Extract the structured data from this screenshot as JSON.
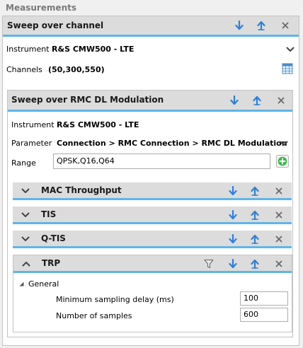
{
  "panel": {
    "title": "Measurements"
  },
  "sweep_channel": {
    "title": "Sweep over channel",
    "instrument_label": "Instrument",
    "instrument_value": "R&S CMW500 - LTE",
    "channels_label": "Channels",
    "channels_value": "(50,300,550)"
  },
  "sweep_rmc": {
    "title": "Sweep over RMC DL Modulation",
    "instrument_label": "Instrument",
    "instrument_value": "R&S CMW500 - LTE",
    "parameter_label": "Parameter",
    "parameter_value": "Connection > RMC Connection > RMC DL Modulation",
    "range_label": "Range",
    "range_value": "QPSK,Q16,Q64"
  },
  "subitems": {
    "mac": {
      "title": "MAC Throughput"
    },
    "tis": {
      "title": "TIS"
    },
    "qtis": {
      "title": "Q-TIS"
    },
    "trp": {
      "title": "TRP",
      "group_label": "General",
      "fields": [
        {
          "label": "Minimum sampling delay (ms)",
          "value": "100"
        },
        {
          "label": "Number of samples",
          "value": "600"
        }
      ]
    }
  },
  "colors": {
    "accent_blue": "#2f7fd6",
    "header_underline": "#5eb5e8",
    "add_green": "#3cb54a"
  }
}
